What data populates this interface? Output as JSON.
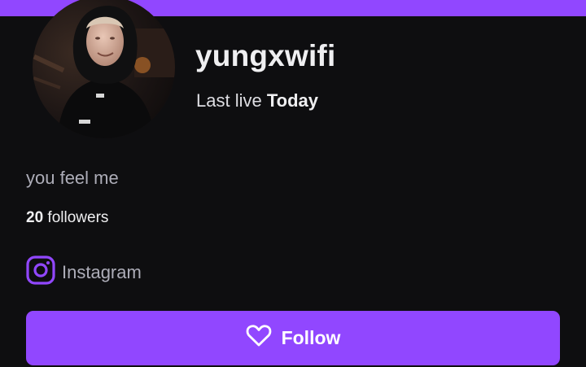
{
  "channel": {
    "username": "yungxwifi",
    "last_live_prefix": "Last live",
    "last_live_value": "Today",
    "bio": "you feel me",
    "followers_count": "20",
    "followers_label": "followers"
  },
  "social": {
    "icon": "instagram-icon",
    "label": "Instagram"
  },
  "follow_button": {
    "icon": "heart-icon",
    "label": "Follow"
  },
  "colors": {
    "accent": "#9147ff",
    "background": "#0e0e10",
    "text_primary": "#efeff1",
    "text_secondary": "#adadb8"
  }
}
